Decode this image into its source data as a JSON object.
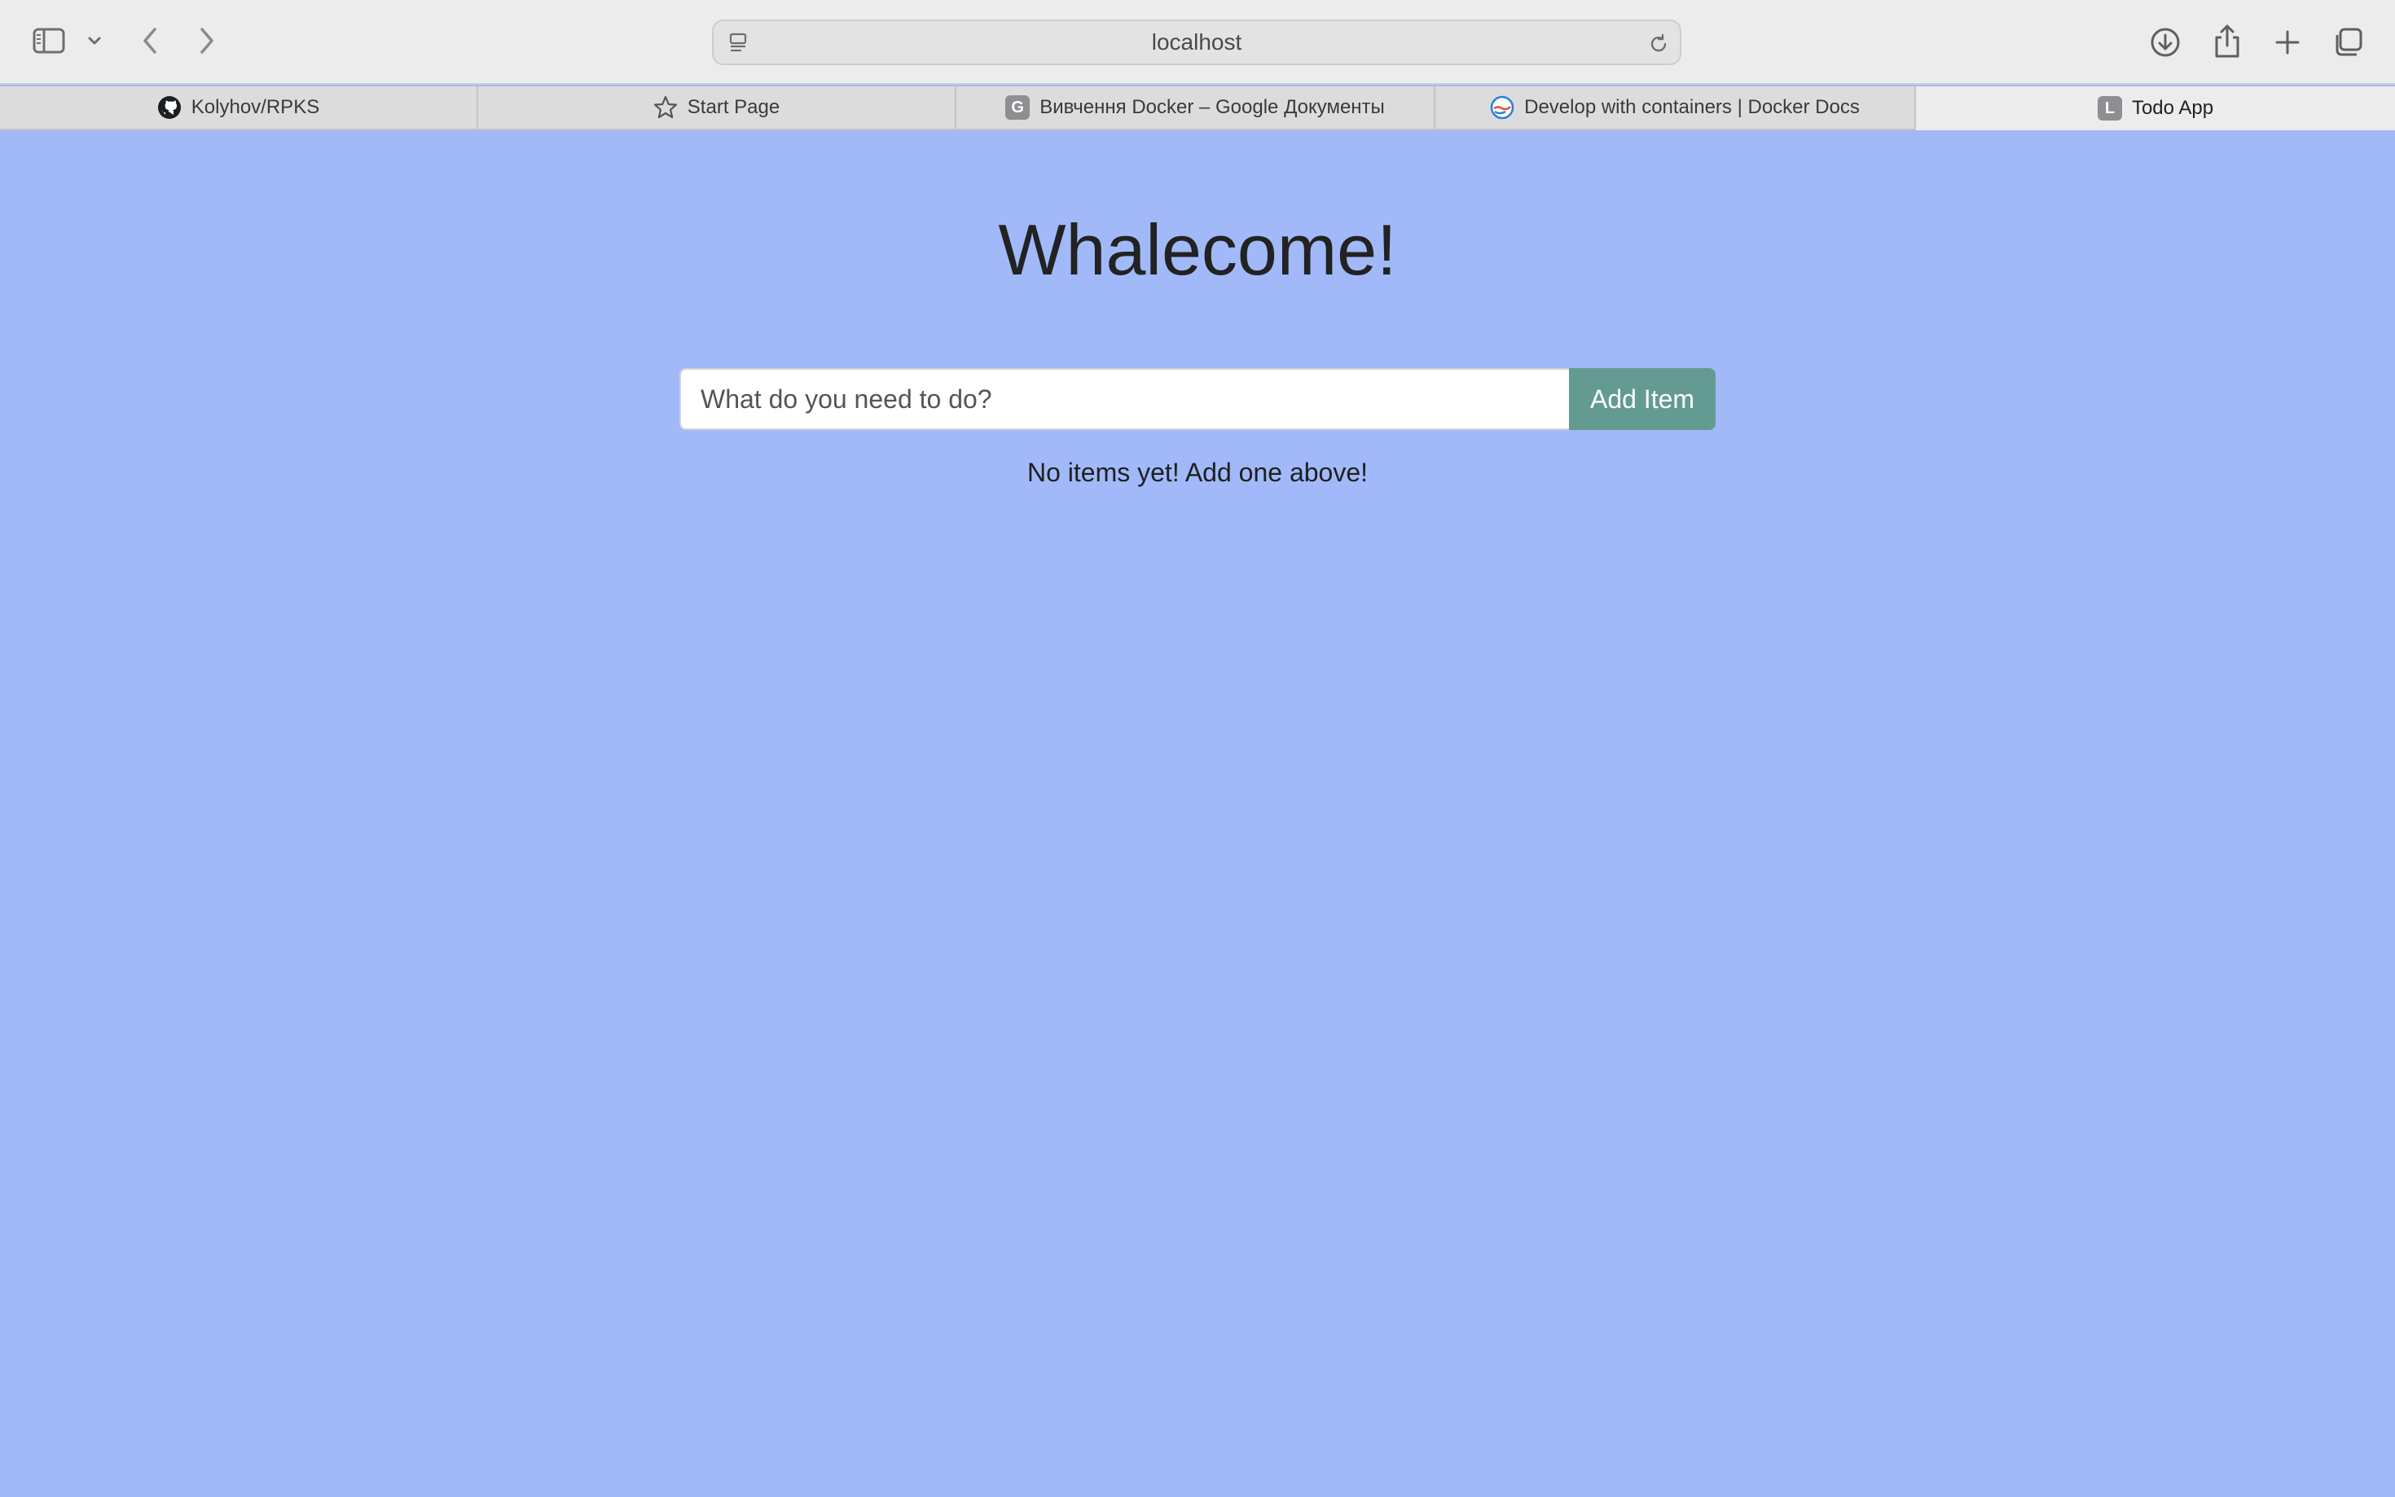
{
  "browser": {
    "address": "localhost",
    "tabs": [
      {
        "label": "Kolyhov/RPKS",
        "icon": "github-icon"
      },
      {
        "label": "Start Page",
        "icon": "star-icon"
      },
      {
        "label": "Вивчення Docker – Google Документы",
        "icon": "g-favicon",
        "favicon_letter": "G"
      },
      {
        "label": "Develop with containers | Docker Docs",
        "icon": "docker-icon"
      },
      {
        "label": "Todo App",
        "icon": "l-favicon",
        "favicon_letter": "L",
        "active": true
      }
    ]
  },
  "app": {
    "title": "Whalecome!",
    "input_placeholder": "What do you need to do?",
    "add_button_label": "Add Item",
    "empty_message": "No items yet! Add one above!"
  },
  "colors": {
    "page_background": "#a1b9f8",
    "add_button": "#639b92"
  }
}
